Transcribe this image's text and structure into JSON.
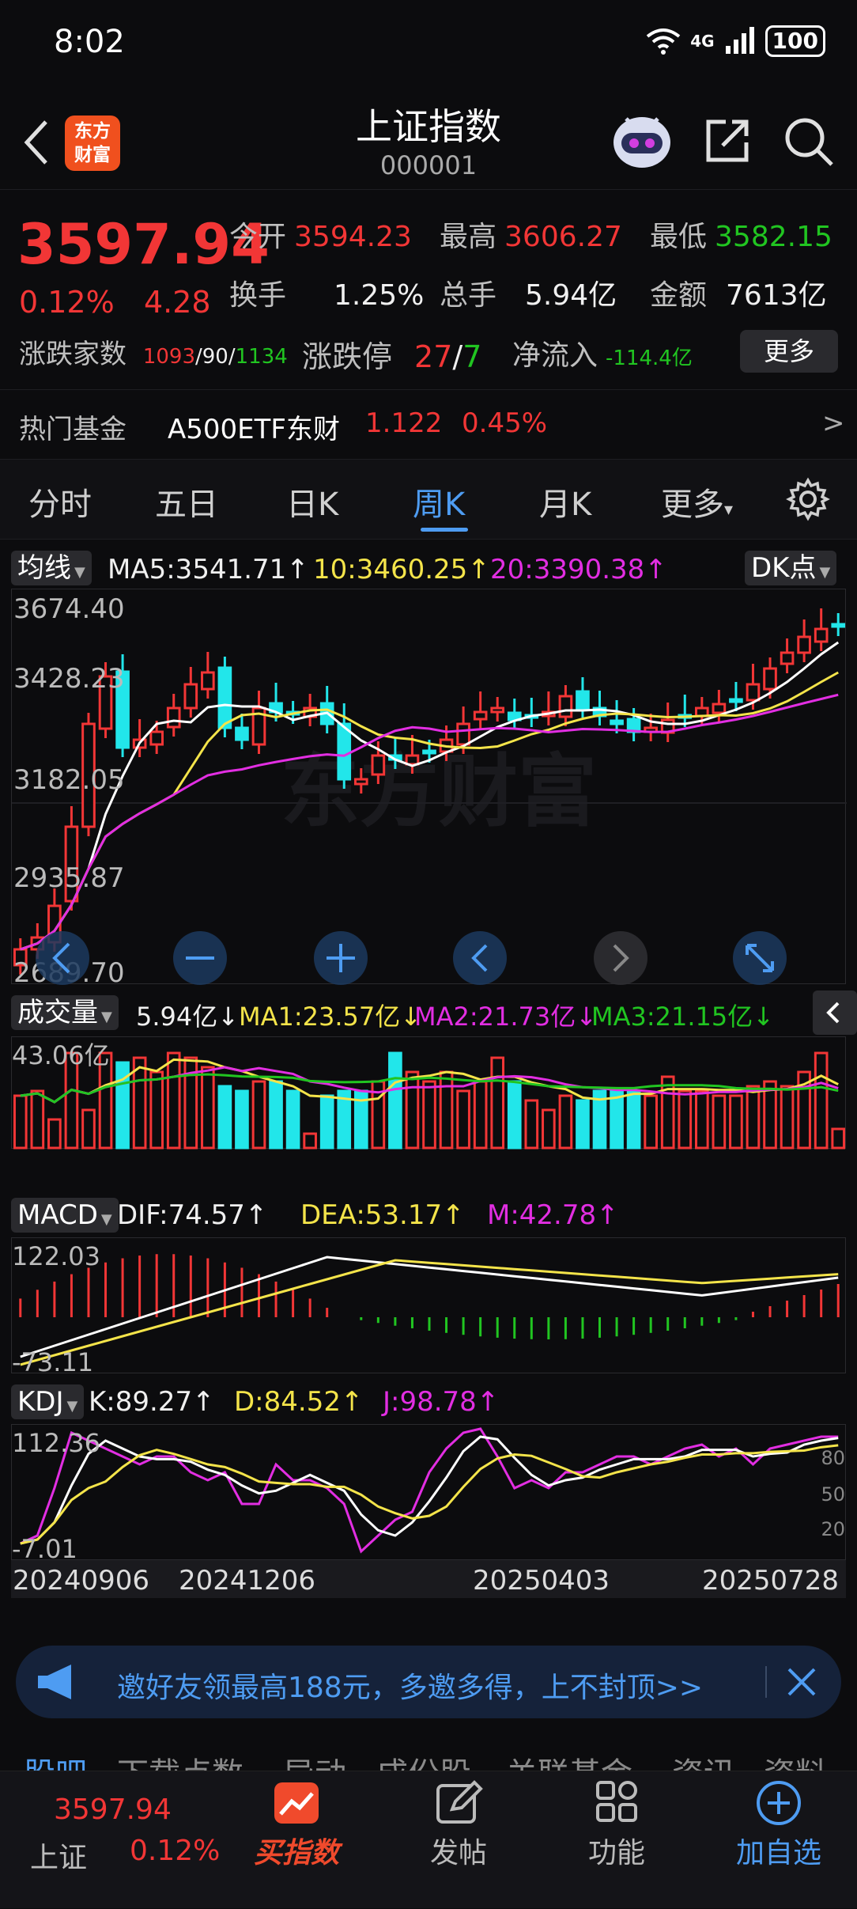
{
  "status": {
    "time": "8:02",
    "network": "4G",
    "battery": "100"
  },
  "header": {
    "logo_line1": "东方",
    "logo_line2": "财富",
    "title": "上证指数",
    "code": "000001"
  },
  "quote": {
    "price": "3597.94",
    "pct": "0.12%",
    "change": "4.28",
    "open_label": "今开",
    "open": "3594.23",
    "high_label": "最高",
    "high": "3606.27",
    "low_label": "最低",
    "low": "3582.15",
    "turnover_label": "换手",
    "turnover": "1.25%",
    "volume_label": "总手",
    "volume": "5.94亿",
    "amount_label": "金额",
    "amount": "7613亿",
    "breadth_label": "涨跌家数",
    "up_count": "1093",
    "flat_count": "90",
    "down_count": "1134",
    "sep": "/",
    "limit_label": "涨跌停",
    "limit_up": "27",
    "limit_down": "7",
    "netflow_label": "净流入",
    "netflow": "-114.4亿",
    "more_label": "更多",
    "fund_label": "热门基金",
    "fund_name": "A500ETF东财",
    "fund_price": "1.122",
    "fund_pct": "0.45%",
    "fund_arrow": ">"
  },
  "tabs": [
    "分时",
    "五日",
    "日K",
    "周K",
    "月K",
    "更多"
  ],
  "tab_more_caret": "▾",
  "kline": {
    "indicator": "均线",
    "ma5": "MA5:3541.71↑",
    "ma10": "10:3460.25↑",
    "ma20": "20:3390.38↑",
    "dk_label": "DK点",
    "axis": [
      "3674.40",
      "3428.23",
      "3182.05",
      "2935.87",
      "2689.70"
    ],
    "watermark": "东方财富"
  },
  "volume": {
    "indicator": "成交量",
    "value": "5.94亿↓",
    "ma1": "MA1:23.57亿↓",
    "ma2": "MA2:21.73亿↓",
    "ma3": "MA3:21.15亿↓",
    "axis_top": "43.06亿"
  },
  "macd": {
    "indicator": "MACD",
    "dif": "DIF:74.57↑",
    "dea": "DEA:53.17↑",
    "m": "M:42.78↑",
    "axis_top": "122.03",
    "axis_bottom": "-73.11"
  },
  "kdj": {
    "indicator": "KDJ",
    "k": "K:89.27↑",
    "d": "D:84.52↑",
    "j": "J:98.78↑",
    "axis_top": "112.36",
    "axis_bottom": "-7.01",
    "levels": [
      "80",
      "50",
      "20"
    ],
    "dates": [
      "20240906",
      "20241206",
      "20250403",
      "20250728"
    ]
  },
  "banner": {
    "text": "邀好友领最高188元，多邀多得，上不封顶>>"
  },
  "sub_tabs": [
    "股吧",
    "下载点数",
    "异动",
    "成份股",
    "关联基金",
    "资讯",
    "资料"
  ],
  "bottom_nav": {
    "mini_price": "3597.94",
    "mini_name": "上证",
    "mini_pct": "0.12%",
    "buy_label": "买指数",
    "post_label": "发帖",
    "func_label": "功能",
    "watch_label": "加自选"
  },
  "colors": {
    "up": "#f23636",
    "down": "#22e6ea",
    "accent": "#4e9cf2",
    "ma5": "#ffffff",
    "ma10": "#f4e44a",
    "ma20": "#e22ee2"
  }
}
